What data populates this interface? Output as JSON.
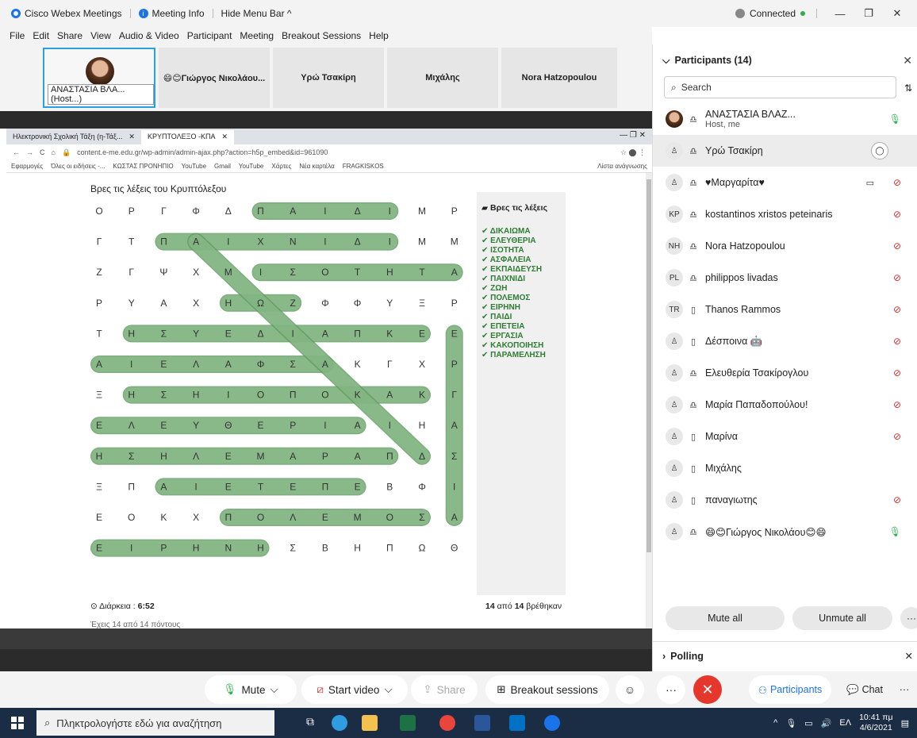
{
  "titlebar": {
    "app_name": "Cisco Webex Meetings",
    "meeting_info": "Meeting Info",
    "hide_menu": "Hide Menu Bar ^",
    "connected": "Connected",
    "min": "—",
    "restore": "❐",
    "close": "✕"
  },
  "menu": [
    "File",
    "Edit",
    "Share",
    "View",
    "Audio & Video",
    "Participant",
    "Meeting",
    "Breakout Sessions",
    "Help"
  ],
  "strip": {
    "host_label": "ΑΝΑΣΤΑΣΙΑ ΒΛΑ... (Host...)",
    "tiles": [
      "😄😊Γιώργος Νικολάου...",
      "Υρώ Τσακίρη",
      "Μιχάλης",
      "Nora Hatzopoulou"
    ]
  },
  "browser": {
    "tab1": "Ηλεκτρονική Σχολική Τάξη (η-Τάξ...",
    "tab2": "ΚΡΥΠΤΟΛΕΞΟ -ΚΠΑ",
    "url": "content.e-me.edu.gr/wp-admin/admin-ajax.php?action=h5p_embed&id=961090",
    "bookmarks": [
      "Εφαρμογές",
      "Όλες οι ειδήσεις -...",
      "ΚΩΣΤΑΣ ΠΡΟΝΗΠΙΟ",
      "YouTube",
      "Gmail",
      "YouTube",
      "Χάρτες",
      "Νέα καρτέλα",
      "FRAGKISKOS"
    ],
    "reading_list": "Λίστα ανάγνωσης"
  },
  "puzzle": {
    "title": "Βρες τις λέξεις του Κρυπτόλεξου",
    "grid": [
      [
        "Ο",
        "Ρ",
        "Γ",
        "Φ",
        "Δ",
        "Π",
        "Α",
        "Ι",
        "Δ",
        "Ι",
        "Μ",
        "Ρ"
      ],
      [
        "Γ",
        "Τ",
        "Π",
        "Α",
        "Ι",
        "Χ",
        "Ν",
        "Ι",
        "Δ",
        "Ι",
        "Μ",
        "Μ"
      ],
      [
        "Ζ",
        "Γ",
        "Ψ",
        "Χ",
        "Μ",
        "Ι",
        "Σ",
        "Ο",
        "Τ",
        "Η",
        "Τ",
        "Α"
      ],
      [
        "Ρ",
        "Υ",
        "Α",
        "Χ",
        "Η",
        "Ω",
        "Ζ",
        "Φ",
        "Φ",
        "Υ",
        "Ξ",
        "Ρ"
      ],
      [
        "Τ",
        "Η",
        "Σ",
        "Υ",
        "Ε",
        "Δ",
        "Ι",
        "Α",
        "Π",
        "Κ",
        "Ε",
        "Ε"
      ],
      [
        "Α",
        "Ι",
        "Ε",
        "Λ",
        "Α",
        "Φ",
        "Σ",
        "Α",
        "Κ",
        "Γ",
        "Χ",
        "Ρ"
      ],
      [
        "Ξ",
        "Η",
        "Σ",
        "Η",
        "Ι",
        "Ο",
        "Π",
        "Ο",
        "Κ",
        "Α",
        "Κ",
        "Γ"
      ],
      [
        "Ε",
        "Λ",
        "Ε",
        "Υ",
        "Θ",
        "Ε",
        "Ρ",
        "Ι",
        "Α",
        "Ι",
        "Η",
        "Α"
      ],
      [
        "Η",
        "Σ",
        "Η",
        "Λ",
        "Ε",
        "Μ",
        "Α",
        "Ρ",
        "Α",
        "Π",
        "Δ",
        "Σ"
      ],
      [
        "Ξ",
        "Π",
        "Α",
        "Ι",
        "Ε",
        "Τ",
        "Ε",
        "Π",
        "Ε",
        "Β",
        "Φ",
        "Ι"
      ],
      [
        "Ε",
        "Ο",
        "Κ",
        "Χ",
        "Π",
        "Ο",
        "Λ",
        "Ε",
        "Μ",
        "Ο",
        "Σ",
        "Α"
      ],
      [
        "Ε",
        "Ι",
        "Ρ",
        "Η",
        "Ν",
        "Η",
        "Σ",
        "Β",
        "Η",
        "Π",
        "Ω",
        "Θ"
      ]
    ],
    "found_title": "Βρες τις λέξεις",
    "words": [
      "ΔΙΚΑΙΩΜΑ",
      "ΕΛΕΥΘΕΡΙΑ",
      "ΙΣΟΤΗΤΑ",
      "ΑΣΦΑΛΕΙΑ",
      "ΕΚΠΑΙΔΕΥΣΗ",
      "ΠΑΙΧΝΙΔΙ",
      "ΖΩΗ",
      "ΠΟΛΕΜΟΣ",
      "ΕΙΡΗΝΗ",
      "ΠΑΙΔΙ",
      "ΕΠΕΤΕΙΑ",
      "ΕΡΓΑΣΙΑ",
      "ΚΑΚΟΠΟΙΗΣΗ",
      "ΠΑΡΑΜΕΛΗΣΗ"
    ],
    "duration_label": "Διάρκεια :",
    "duration_value": "6:52",
    "found_count_a": "14",
    "found_count_mid": "από",
    "found_count_b": "14",
    "found_count_end": "βρέθηκαν",
    "score_text": "Έχεις 14 από 14 πόντους"
  },
  "participants": {
    "header": "Participants (14)",
    "search_placeholder": "Search",
    "list": [
      {
        "name": "ΑΝΑΣΤΑΣΙΑ ΒΛΑΖ...",
        "sub": "Host, me",
        "initials": "",
        "device": "headset",
        "mic": "on"
      },
      {
        "name": "Υρώ Τσακίρη",
        "sub": "",
        "initials": "",
        "device": "headset",
        "mic": "none"
      },
      {
        "name": "♥Μαργαρίτα♥",
        "sub": "",
        "initials": "",
        "device": "headset",
        "mic": "muted"
      },
      {
        "name": "kostantinos xristos peteinaris",
        "sub": "",
        "initials": "KP",
        "device": "headset",
        "mic": "muted"
      },
      {
        "name": "Nora Hatzopoulou",
        "sub": "",
        "initials": "NH",
        "device": "headset",
        "mic": "muted"
      },
      {
        "name": "philippos livadas",
        "sub": "",
        "initials": "PL",
        "device": "headset",
        "mic": "muted"
      },
      {
        "name": "Thanos Rammos",
        "sub": "",
        "initials": "TR",
        "device": "phone",
        "mic": "muted"
      },
      {
        "name": "Δέσποινα 🤖",
        "sub": "",
        "initials": "",
        "device": "phone",
        "mic": "muted"
      },
      {
        "name": "Ελευθερία Τσακίρογλου",
        "sub": "",
        "initials": "",
        "device": "headset",
        "mic": "muted"
      },
      {
        "name": "Μαρία Παπαδοπούλου!",
        "sub": "",
        "initials": "",
        "device": "headset",
        "mic": "muted"
      },
      {
        "name": "Μαρίνα",
        "sub": "",
        "initials": "",
        "device": "phone",
        "mic": "muted"
      },
      {
        "name": "Μιχάλης",
        "sub": "",
        "initials": "",
        "device": "phone",
        "mic": "none"
      },
      {
        "name": "παναγιωτης",
        "sub": "",
        "initials": "",
        "device": "phone",
        "mic": "muted"
      },
      {
        "name": "😄😊Γιώργος Νικολάου😊😄",
        "sub": "",
        "initials": "",
        "device": "headset",
        "mic": "on"
      }
    ],
    "mute_all": "Mute all",
    "unmute_all": "Unmute all",
    "polling": "Polling"
  },
  "controls": {
    "mute": "Mute",
    "start_video": "Start video",
    "share": "Share",
    "breakout": "Breakout sessions",
    "participants": "Participants",
    "chat": "Chat"
  },
  "taskbar": {
    "search_placeholder": "Πληκτρολογήστε εδώ για αναζήτηση",
    "lang": "ΕΛ",
    "time": "10:41 πμ",
    "date": "4/6/2021"
  },
  "colors": {
    "accent": "#1a73e8",
    "highlight_fill": "#8fbf8f",
    "highlight_stroke": "#5f9a5f",
    "found_green": "#2e7d32",
    "end_red": "#e5372c",
    "taskbar": "#1b2c45"
  }
}
